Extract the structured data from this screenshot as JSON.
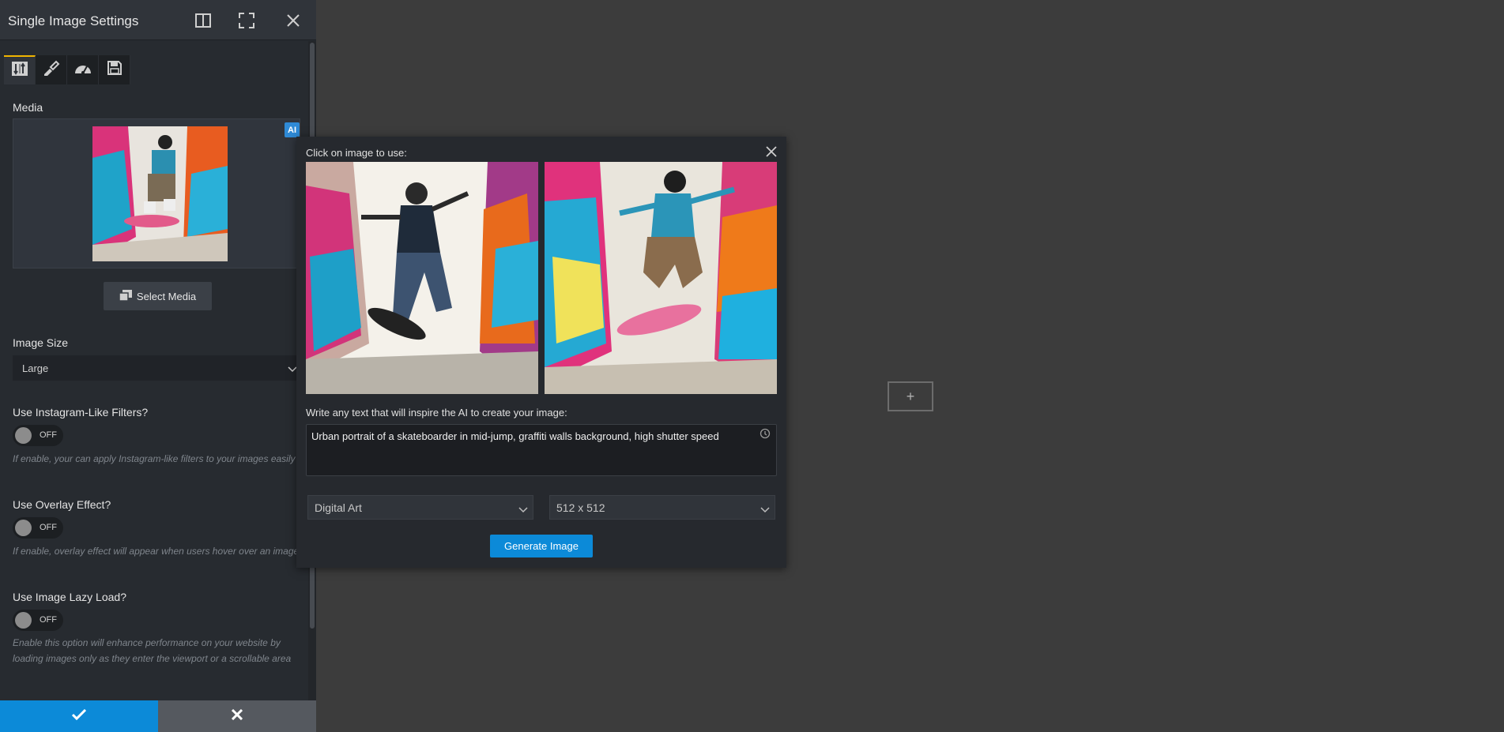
{
  "panel": {
    "title": "Single Image Settings",
    "tabs": [
      {
        "icon": "sliders-icon",
        "active": true
      },
      {
        "icon": "brush-icon",
        "active": false
      },
      {
        "icon": "gauge-icon",
        "active": false
      },
      {
        "icon": "save-icon",
        "active": false
      }
    ],
    "media": {
      "label": "Media",
      "ai_badge": "AI",
      "select_button": "Select Media"
    },
    "image_size": {
      "label": "Image Size",
      "value": "Large"
    },
    "instagram_filters": {
      "label": "Use Instagram-Like Filters?",
      "state": "OFF",
      "help": "If enable, your can apply Instagram-like filters to your images easily"
    },
    "overlay": {
      "label": "Use Overlay Effect?",
      "state": "OFF",
      "help": "If enable, overlay effect will appear when users hover over an image"
    },
    "lazy_load": {
      "label": "Use Image Lazy Load?",
      "state": "OFF",
      "help": "Enable this option will enhance performance on your website by loading images only as they enter the viewport or a scrollable area"
    }
  },
  "ai_modal": {
    "hint": "Click on image to use:",
    "prompt_label": "Write any text that will inspire the AI to create your image:",
    "prompt_value": "Urban portrait of a skateboarder in mid-jump, graffiti walls background, high shutter speed",
    "style": "Digital Art",
    "size": "512 x 512",
    "generate_button": "Generate Image"
  },
  "canvas": {
    "add_symbol": "+"
  },
  "colors": {
    "accent": "#0c8ad8",
    "tab_active": "#f0b400",
    "panel_bg": "#272b30",
    "canvas_bg": "#3c3c3c"
  }
}
